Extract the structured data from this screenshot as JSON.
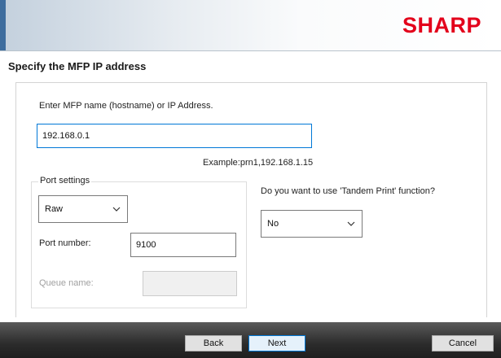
{
  "header": {
    "logo_text": "SHARP",
    "brand_color": "#e3001b"
  },
  "page_title": "Specify the MFP IP address",
  "hostname": {
    "label": "Enter MFP name (hostname) or IP Address.",
    "value": "192.168.0.1",
    "example": "Example:prn1,192.168.1.15"
  },
  "port_settings": {
    "legend": "Port settings",
    "type_selected": "Raw",
    "port_number_label": "Port number:",
    "port_number_value": "9100",
    "queue_name_label": "Queue name:",
    "queue_name_value": ""
  },
  "tandem": {
    "question": "Do you want to use 'Tandem Print' function?",
    "selected": "No"
  },
  "footer": {
    "back_label": "Back",
    "next_label": "Next",
    "cancel_label": "Cancel"
  }
}
